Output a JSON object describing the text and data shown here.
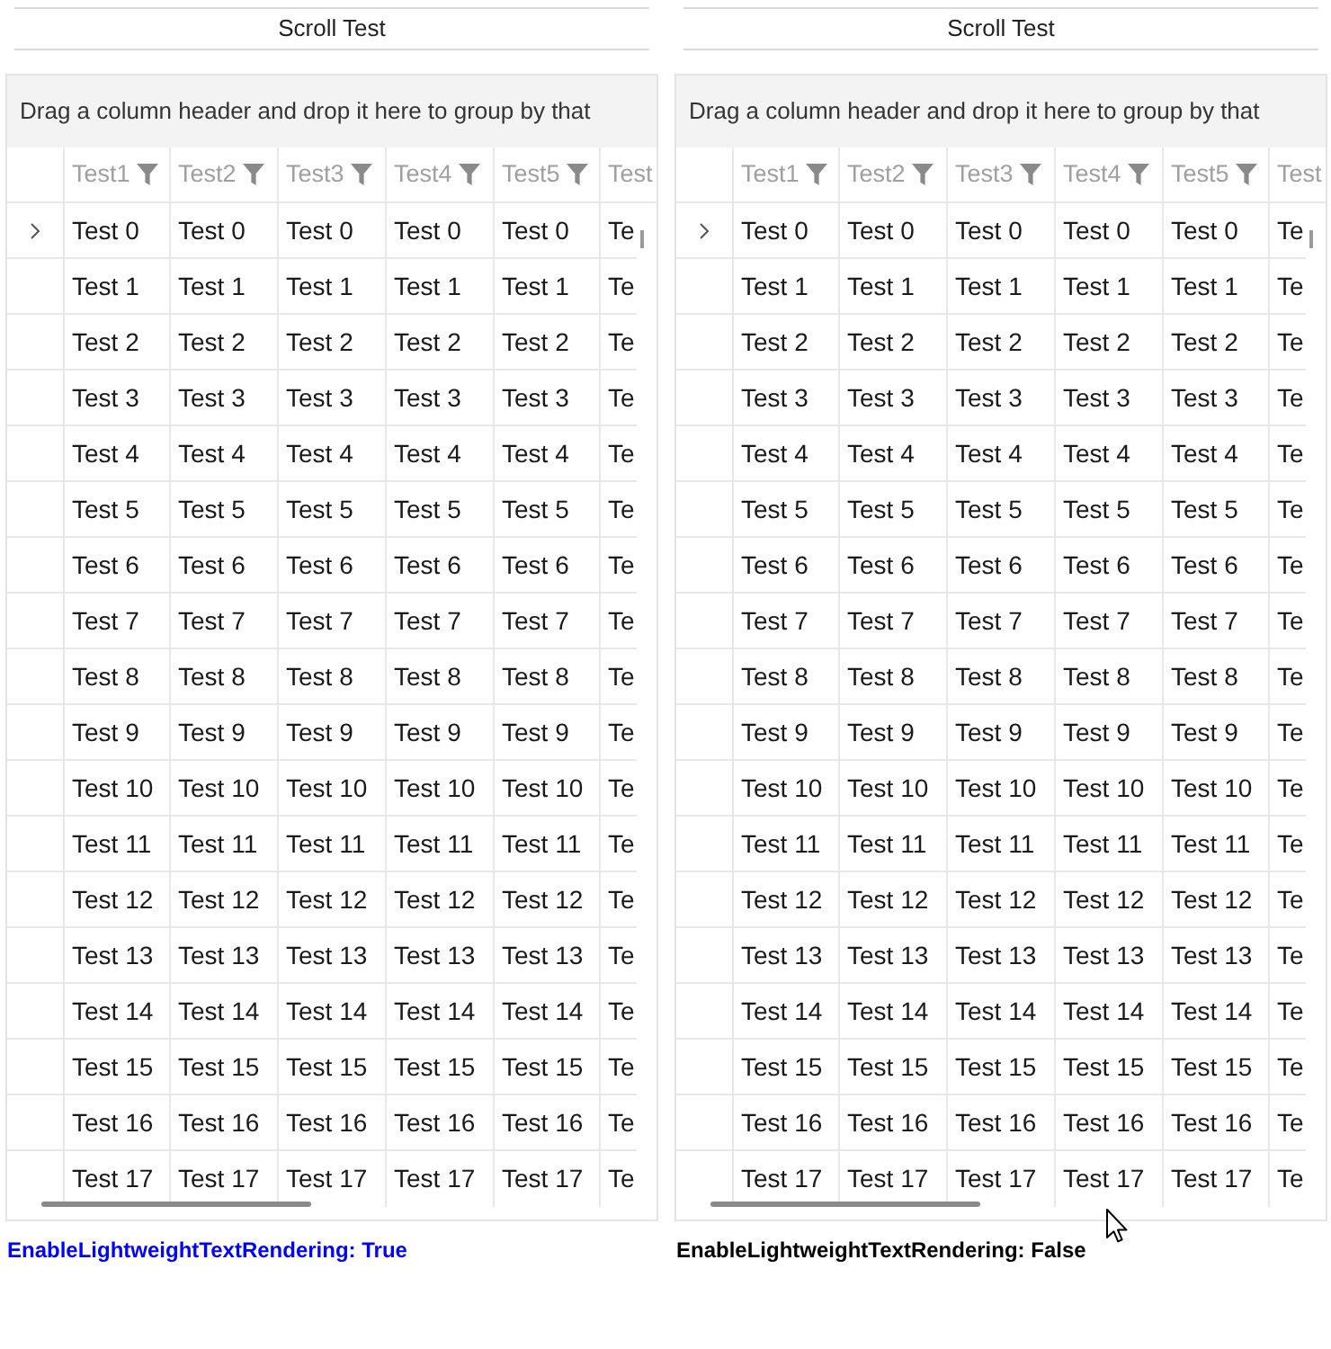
{
  "panels": [
    {
      "title": "Scroll Test",
      "group_hint": "Drag a column header and drop it here to group by that",
      "columns": [
        {
          "label": "Test1",
          "filter_icon": true
        },
        {
          "label": "Test2",
          "filter_icon": true
        },
        {
          "label": "Test3",
          "filter_icon": true
        },
        {
          "label": "Test4",
          "filter_icon": true
        },
        {
          "label": "Test5",
          "filter_icon": true
        },
        {
          "label": "Test",
          "filter_icon": false
        }
      ],
      "rows": [
        {
          "current": true,
          "cells": [
            "Test 0",
            "Test 0",
            "Test 0",
            "Test 0",
            "Test 0",
            "Te"
          ]
        },
        {
          "current": false,
          "cells": [
            "Test 1",
            "Test 1",
            "Test 1",
            "Test 1",
            "Test 1",
            "Te"
          ]
        },
        {
          "current": false,
          "cells": [
            "Test 2",
            "Test 2",
            "Test 2",
            "Test 2",
            "Test 2",
            "Te"
          ]
        },
        {
          "current": false,
          "cells": [
            "Test 3",
            "Test 3",
            "Test 3",
            "Test 3",
            "Test 3",
            "Te"
          ]
        },
        {
          "current": false,
          "cells": [
            "Test 4",
            "Test 4",
            "Test 4",
            "Test 4",
            "Test 4",
            "Te"
          ]
        },
        {
          "current": false,
          "cells": [
            "Test 5",
            "Test 5",
            "Test 5",
            "Test 5",
            "Test 5",
            "Te"
          ]
        },
        {
          "current": false,
          "cells": [
            "Test 6",
            "Test 6",
            "Test 6",
            "Test 6",
            "Test 6",
            "Te"
          ]
        },
        {
          "current": false,
          "cells": [
            "Test 7",
            "Test 7",
            "Test 7",
            "Test 7",
            "Test 7",
            "Te"
          ]
        },
        {
          "current": false,
          "cells": [
            "Test 8",
            "Test 8",
            "Test 8",
            "Test 8",
            "Test 8",
            "Te"
          ]
        },
        {
          "current": false,
          "cells": [
            "Test 9",
            "Test 9",
            "Test 9",
            "Test 9",
            "Test 9",
            "Te"
          ]
        },
        {
          "current": false,
          "cells": [
            "Test 10",
            "Test 10",
            "Test 10",
            "Test 10",
            "Test 10",
            "Te"
          ]
        },
        {
          "current": false,
          "cells": [
            "Test 11",
            "Test 11",
            "Test 11",
            "Test 11",
            "Test 11",
            "Te"
          ]
        },
        {
          "current": false,
          "cells": [
            "Test 12",
            "Test 12",
            "Test 12",
            "Test 12",
            "Test 12",
            "Te"
          ]
        },
        {
          "current": false,
          "cells": [
            "Test 13",
            "Test 13",
            "Test 13",
            "Test 13",
            "Test 13",
            "Te"
          ]
        },
        {
          "current": false,
          "cells": [
            "Test 14",
            "Test 14",
            "Test 14",
            "Test 14",
            "Test 14",
            "Te"
          ]
        },
        {
          "current": false,
          "cells": [
            "Test 15",
            "Test 15",
            "Test 15",
            "Test 15",
            "Test 15",
            "Te"
          ]
        },
        {
          "current": false,
          "cells": [
            "Test 16",
            "Test 16",
            "Test 16",
            "Test 16",
            "Test 16",
            "Te"
          ]
        },
        {
          "current": false,
          "cells": [
            "Test 17",
            "Test 17",
            "Test 17",
            "Test 17",
            "Test 17",
            "Te"
          ]
        }
      ],
      "status": {
        "text": "EnableLightweightTextRendering: True",
        "color": "#0000ff"
      }
    },
    {
      "title": "Scroll Test",
      "group_hint": "Drag a column header and drop it here to group by that",
      "columns": [
        {
          "label": "Test1",
          "filter_icon": true
        },
        {
          "label": "Test2",
          "filter_icon": true
        },
        {
          "label": "Test3",
          "filter_icon": true
        },
        {
          "label": "Test4",
          "filter_icon": true
        },
        {
          "label": "Test5",
          "filter_icon": true
        },
        {
          "label": "Test",
          "filter_icon": false
        }
      ],
      "rows": [
        {
          "current": true,
          "cells": [
            "Test 0",
            "Test 0",
            "Test 0",
            "Test 0",
            "Test 0",
            "Te"
          ]
        },
        {
          "current": false,
          "cells": [
            "Test 1",
            "Test 1",
            "Test 1",
            "Test 1",
            "Test 1",
            "Te"
          ]
        },
        {
          "current": false,
          "cells": [
            "Test 2",
            "Test 2",
            "Test 2",
            "Test 2",
            "Test 2",
            "Te"
          ]
        },
        {
          "current": false,
          "cells": [
            "Test 3",
            "Test 3",
            "Test 3",
            "Test 3",
            "Test 3",
            "Te"
          ]
        },
        {
          "current": false,
          "cells": [
            "Test 4",
            "Test 4",
            "Test 4",
            "Test 4",
            "Test 4",
            "Te"
          ]
        },
        {
          "current": false,
          "cells": [
            "Test 5",
            "Test 5",
            "Test 5",
            "Test 5",
            "Test 5",
            "Te"
          ]
        },
        {
          "current": false,
          "cells": [
            "Test 6",
            "Test 6",
            "Test 6",
            "Test 6",
            "Test 6",
            "Te"
          ]
        },
        {
          "current": false,
          "cells": [
            "Test 7",
            "Test 7",
            "Test 7",
            "Test 7",
            "Test 7",
            "Te"
          ]
        },
        {
          "current": false,
          "cells": [
            "Test 8",
            "Test 8",
            "Test 8",
            "Test 8",
            "Test 8",
            "Te"
          ]
        },
        {
          "current": false,
          "cells": [
            "Test 9",
            "Test 9",
            "Test 9",
            "Test 9",
            "Test 9",
            "Te"
          ]
        },
        {
          "current": false,
          "cells": [
            "Test 10",
            "Test 10",
            "Test 10",
            "Test 10",
            "Test 10",
            "Te"
          ]
        },
        {
          "current": false,
          "cells": [
            "Test 11",
            "Test 11",
            "Test 11",
            "Test 11",
            "Test 11",
            "Te"
          ]
        },
        {
          "current": false,
          "cells": [
            "Test 12",
            "Test 12",
            "Test 12",
            "Test 12",
            "Test 12",
            "Te"
          ]
        },
        {
          "current": false,
          "cells": [
            "Test 13",
            "Test 13",
            "Test 13",
            "Test 13",
            "Test 13",
            "Te"
          ]
        },
        {
          "current": false,
          "cells": [
            "Test 14",
            "Test 14",
            "Test 14",
            "Test 14",
            "Test 14",
            "Te"
          ]
        },
        {
          "current": false,
          "cells": [
            "Test 15",
            "Test 15",
            "Test 15",
            "Test 15",
            "Test 15",
            "Te"
          ]
        },
        {
          "current": false,
          "cells": [
            "Test 16",
            "Test 16",
            "Test 16",
            "Test 16",
            "Test 16",
            "Te"
          ]
        },
        {
          "current": false,
          "cells": [
            "Test 17",
            "Test 17",
            "Test 17",
            "Test 17",
            "Test 17",
            "Te"
          ]
        }
      ],
      "status": {
        "text": "EnableLightweightTextRendering: False",
        "color": "#000000"
      }
    }
  ]
}
